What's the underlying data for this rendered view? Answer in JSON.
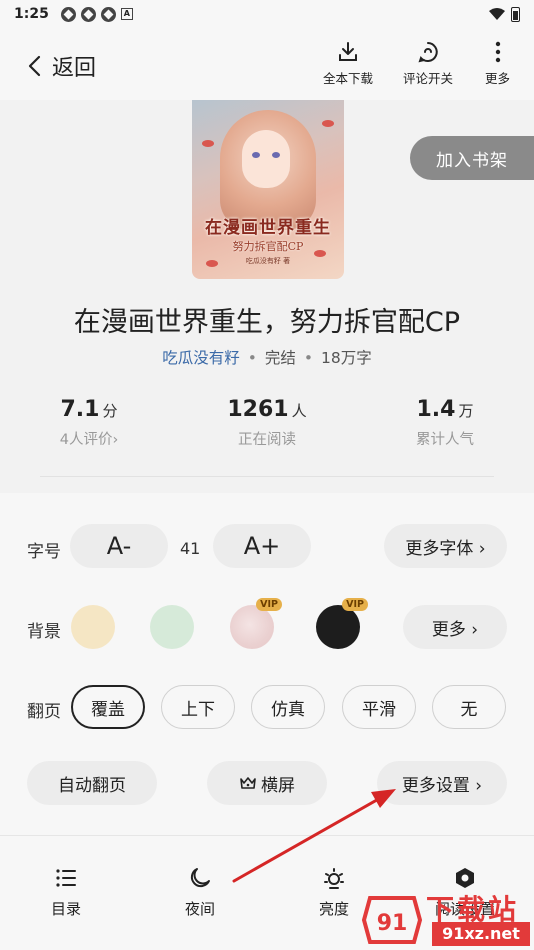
{
  "status": {
    "time": "1:25"
  },
  "nav": {
    "back_label": "返回",
    "actions": [
      "全本下载",
      "评论开关",
      "更多"
    ]
  },
  "book": {
    "cover": {
      "title": "在漫画世界重生",
      "subtitle": "努力拆官配CP",
      "author": "吃瓜没有籽 著"
    },
    "add_shelf": "加入书架",
    "title": "在漫画世界重生，努力拆官配CP",
    "author": "吃瓜没有籽",
    "status": "完结",
    "words": "18万字",
    "sep": "•",
    "stats": [
      {
        "value": "7.1",
        "unit": "分",
        "label": "4人评价›"
      },
      {
        "value": "1261",
        "unit": "人",
        "label": "正在阅读"
      },
      {
        "value": "1.4",
        "unit": "万",
        "label": "累计人气"
      }
    ]
  },
  "settings": {
    "font": {
      "label": "字号",
      "decrease": "A-",
      "increase": "A+",
      "size": "41",
      "more": "更多字体 ›"
    },
    "background": {
      "label": "背景",
      "vip": "VIP",
      "more": "更多 ›",
      "colors": [
        "#f5e6c4",
        "#d6ead9",
        "#f0dede",
        "#1d1d1d"
      ]
    },
    "paging": {
      "label": "翻页",
      "options": [
        "覆盖",
        "上下",
        "仿真",
        "平滑",
        "无"
      ],
      "selected": "覆盖"
    },
    "auto_page": "自动翻页",
    "landscape": "横屏",
    "more_settings": "更多设置 ›"
  },
  "tabs": [
    "目录",
    "夜间",
    "亮度",
    "阅读设置"
  ],
  "watermark": {
    "text": "下载站",
    "url": "91xz.net"
  },
  "colors": {
    "accent_link": "#3b6aa8",
    "annotation": "#e23a3a"
  }
}
